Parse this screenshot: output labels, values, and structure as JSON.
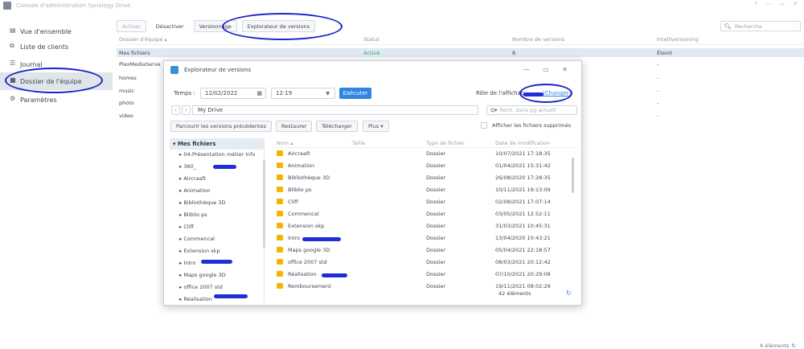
{
  "window": {
    "title": "Console d'administration Synology Drive",
    "controls": "? — ▭ ✕"
  },
  "sidebar": {
    "items": [
      {
        "label": "Vue d'ensemble",
        "icon": "overview-icon"
      },
      {
        "label": "Liste de clients",
        "icon": "client-list-icon"
      },
      {
        "label": "Journal",
        "icon": "log-icon"
      },
      {
        "label": "Dossier de l'équipe",
        "icon": "team-folder-icon"
      },
      {
        "label": "Paramètres",
        "icon": "gear-icon"
      }
    ]
  },
  "toolbar": {
    "activate": "Activer",
    "deactivate": "Désactiver",
    "versioning": "Versionnage",
    "version_explorer": "Explorateur de versions",
    "search_placeholder": "Recherche"
  },
  "grid": {
    "headers": [
      "Dossier d'équipe ▴",
      "Statut",
      "Nombre de versions",
      "Intelliversioning"
    ],
    "rows": [
      {
        "name": "Mes fichiers",
        "status": "Activé",
        "versions": "8",
        "intelli": "Éteint"
      },
      {
        "name": "PlexMediaServe",
        "status": "",
        "versions": "",
        "intelli": "-"
      },
      {
        "name": "homes",
        "status": "",
        "versions": "",
        "intelli": "-"
      },
      {
        "name": "music",
        "status": "",
        "versions": "",
        "intelli": "-"
      },
      {
        "name": "photo",
        "status": "",
        "versions": "",
        "intelli": "-"
      },
      {
        "name": "video",
        "status": "",
        "versions": "",
        "intelli": "-"
      }
    ],
    "footer_count": "6 éléments"
  },
  "dialog": {
    "title": "Explorateur de versions",
    "time_label": "Temps :",
    "date": "12/02/2022",
    "time": "12:19",
    "execute": "Exécuter",
    "role_label": "Rôle de l'affichag",
    "change": "(Changer)",
    "path": "My Drive",
    "search_placeholder": "Rech. dans pg actuell",
    "browse_prev": "Parcourir les versions précédentes",
    "restore": "Restaurer",
    "download": "Télécharger",
    "more": "Plus ▾",
    "show_deleted": "Afficher les fichiers supprimés",
    "tree_root": "▾ Mes fichiers",
    "tree_items": [
      "▸ 04-Présentation métier info",
      "▸ 360_",
      "▸ Aircraaft",
      "▸ Animation",
      "▸ Bibliothèque 3D",
      "▸ Bliblio ps",
      "▸ Cliff",
      "▸ Commencal",
      "▸ Extension skp",
      "▸ Intro",
      "▸ Maps google 3D",
      "▸ office 2007 std",
      "▸ Réalisation"
    ],
    "file_headers": {
      "name": "Nom ▴",
      "size": "Taille",
      "type": "Type de fichier",
      "date": "Date de modification"
    },
    "files": [
      {
        "name": "Aircraaft",
        "type": "Dossier",
        "date": "10/07/2021 17:18:35"
      },
      {
        "name": "Animation",
        "type": "Dossier",
        "date": "01/04/2021 15:31:42"
      },
      {
        "name": "Bibliothèque 3D",
        "type": "Dossier",
        "date": "26/08/2020 17:28:35"
      },
      {
        "name": "Bliblio ps",
        "type": "Dossier",
        "date": "10/11/2021 19:13:09"
      },
      {
        "name": "Cliff",
        "type": "Dossier",
        "date": "02/08/2021 17:07:14"
      },
      {
        "name": "Commencal",
        "type": "Dossier",
        "date": "03/05/2021 12:52:11"
      },
      {
        "name": "Extension skp",
        "type": "Dossier",
        "date": "31/03/2021 10:45:31"
      },
      {
        "name": "Intro",
        "type": "Dossier",
        "date": "13/04/2020 10:43:21"
      },
      {
        "name": "Maps google 3D",
        "type": "Dossier",
        "date": "05/04/2021 22:18:57"
      },
      {
        "name": "office 2007 std",
        "type": "Dossier",
        "date": "08/03/2021 20:12:42"
      },
      {
        "name": "Réalisation",
        "type": "Dossier",
        "date": "07/10/2021 20:29:08"
      },
      {
        "name": "Remboursement",
        "type": "Dossier",
        "date": "19/11/2021 08:02:29"
      }
    ],
    "count": "42 éléments"
  },
  "colors": {
    "accent": "#2e86de",
    "selected_row": "#dfe8f3",
    "annotation": "#1a22c8",
    "status_green": "#3bb24a"
  }
}
